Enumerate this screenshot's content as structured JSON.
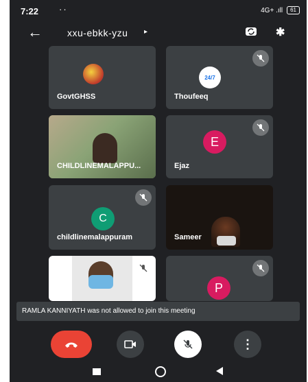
{
  "status": {
    "time": "7:22",
    "dots": "··",
    "signal": "4G+ .ıll",
    "battery": "61"
  },
  "header": {
    "back_icon": "arrow-left-icon",
    "meeting_code": "xxu-ebkk-yzu",
    "caret": "▸",
    "bt": "✱"
  },
  "participants": [
    {
      "name": "GovtGHSS",
      "muted": false
    },
    {
      "name": "Thoufeeq",
      "muted": true,
      "avatar_text": "24/7"
    },
    {
      "name": "CHILDLINEMALAPPU...",
      "muted": false
    },
    {
      "name": "Ejaz",
      "muted": true,
      "initial": "E",
      "color": "#d81b60"
    },
    {
      "name": "childlinemalappuram",
      "muted": true,
      "initial": "C",
      "color": "#0f9d74"
    },
    {
      "name": "Sameer",
      "muted": false
    },
    {
      "name": "",
      "muted": true
    },
    {
      "name": "",
      "muted": true,
      "initial": "P",
      "color": "#d81b60"
    }
  ],
  "toast": {
    "message": "RAMLA KANNIYATH was not allowed to join this meeting"
  },
  "controls": {
    "end_color": "#ea4335",
    "more": "⋮"
  }
}
